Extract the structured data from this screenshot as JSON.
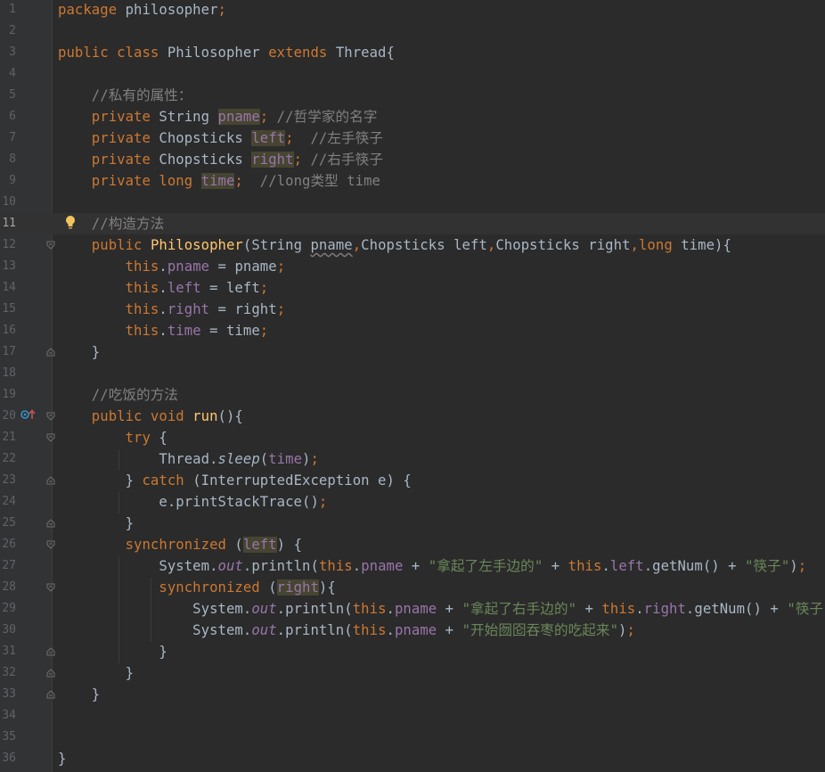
{
  "editor": {
    "current_line": 11,
    "lines": [
      {
        "num": "1",
        "tokens": [
          {
            "c": "kw",
            "t": "package"
          },
          {
            "t": " philosopher"
          },
          {
            "c": "kw",
            "t": ";"
          }
        ]
      },
      {
        "num": "2",
        "tokens": []
      },
      {
        "num": "3",
        "tokens": [
          {
            "c": "kw",
            "t": "public class "
          },
          {
            "t": "Philosopher "
          },
          {
            "c": "kw",
            "t": "extends "
          },
          {
            "t": "Thread{"
          }
        ]
      },
      {
        "num": "4",
        "tokens": []
      },
      {
        "num": "5",
        "tokens": [
          {
            "c": "cmt",
            "t": "    //私有的属性："
          }
        ]
      },
      {
        "num": "6",
        "tokens": [
          {
            "c": "kw",
            "t": "    private "
          },
          {
            "t": "String "
          },
          {
            "c": "fld hl",
            "t": "pname"
          },
          {
            "c": "kw",
            "t": ";"
          },
          {
            "c": "cmt",
            "t": " //哲学家的名字"
          }
        ]
      },
      {
        "num": "7",
        "tokens": [
          {
            "c": "kw",
            "t": "    private "
          },
          {
            "t": "Chopsticks "
          },
          {
            "c": "fld hl",
            "t": "left"
          },
          {
            "c": "kw",
            "t": ";"
          },
          {
            "c": "cmt",
            "t": "  //左手筷子"
          }
        ]
      },
      {
        "num": "8",
        "tokens": [
          {
            "c": "kw",
            "t": "    private "
          },
          {
            "t": "Chopsticks "
          },
          {
            "c": "fld hl",
            "t": "right"
          },
          {
            "c": "kw",
            "t": ";"
          },
          {
            "c": "cmt",
            "t": " //右手筷子"
          }
        ]
      },
      {
        "num": "9",
        "tokens": [
          {
            "c": "kw",
            "t": "    private long "
          },
          {
            "c": "fld hl",
            "t": "time"
          },
          {
            "c": "kw",
            "t": ";"
          },
          {
            "c": "cmt",
            "t": "  //long类型 time"
          }
        ]
      },
      {
        "num": "10",
        "tokens": []
      },
      {
        "num": "11",
        "tokens": [
          {
            "c": "cmt",
            "t": "    //构造方法"
          }
        ]
      },
      {
        "num": "12",
        "tokens": [
          {
            "c": "kw",
            "t": "    public "
          },
          {
            "c": "fn",
            "t": "Philosopher"
          },
          {
            "t": "(String "
          },
          {
            "c": "wav",
            "t": "pname"
          },
          {
            "c": "kw",
            "t": ","
          },
          {
            "t": "Chopsticks left"
          },
          {
            "c": "kw",
            "t": ","
          },
          {
            "t": "Chopsticks right"
          },
          {
            "c": "kw",
            "t": ","
          },
          {
            "c": "kw",
            "t": "long "
          },
          {
            "t": "time){"
          }
        ]
      },
      {
        "num": "13",
        "tokens": [
          {
            "c": "kw",
            "t": "        this"
          },
          {
            "t": "."
          },
          {
            "c": "fld",
            "t": "pname"
          },
          {
            "t": " = pname"
          },
          {
            "c": "kw",
            "t": ";"
          }
        ]
      },
      {
        "num": "14",
        "tokens": [
          {
            "c": "kw",
            "t": "        this"
          },
          {
            "t": "."
          },
          {
            "c": "fld",
            "t": "left"
          },
          {
            "t": " = left"
          },
          {
            "c": "kw",
            "t": ";"
          }
        ]
      },
      {
        "num": "15",
        "tokens": [
          {
            "c": "kw",
            "t": "        this"
          },
          {
            "t": "."
          },
          {
            "c": "fld",
            "t": "right"
          },
          {
            "t": " = right"
          },
          {
            "c": "kw",
            "t": ";"
          }
        ]
      },
      {
        "num": "16",
        "tokens": [
          {
            "c": "kw",
            "t": "        this"
          },
          {
            "t": "."
          },
          {
            "c": "fld",
            "t": "time"
          },
          {
            "t": " = time"
          },
          {
            "c": "kw",
            "t": ";"
          }
        ]
      },
      {
        "num": "17",
        "tokens": [
          {
            "t": "    }"
          }
        ]
      },
      {
        "num": "18",
        "tokens": []
      },
      {
        "num": "19",
        "tokens": [
          {
            "c": "cmt",
            "t": "    //吃饭的方法"
          }
        ]
      },
      {
        "num": "20",
        "tokens": [
          {
            "c": "kw",
            "t": "    public void "
          },
          {
            "c": "fn",
            "t": "run"
          },
          {
            "t": "(){"
          }
        ]
      },
      {
        "num": "21",
        "tokens": [
          {
            "c": "kw",
            "t": "        try "
          },
          {
            "t": "{"
          }
        ]
      },
      {
        "num": "22",
        "tokens": [
          {
            "t": "            Thread."
          },
          {
            "c": "sm",
            "t": "sleep"
          },
          {
            "t": "("
          },
          {
            "c": "fld",
            "t": "time"
          },
          {
            "t": ")"
          },
          {
            "c": "kw",
            "t": ";"
          }
        ]
      },
      {
        "num": "23",
        "tokens": [
          {
            "t": "        } "
          },
          {
            "c": "kw",
            "t": "catch "
          },
          {
            "t": "(InterruptedException e) {"
          }
        ]
      },
      {
        "num": "24",
        "tokens": [
          {
            "t": "            e.printStackTrace()"
          },
          {
            "c": "kw",
            "t": ";"
          }
        ]
      },
      {
        "num": "25",
        "tokens": [
          {
            "t": "        }"
          }
        ]
      },
      {
        "num": "26",
        "tokens": [
          {
            "c": "kw",
            "t": "        synchronized "
          },
          {
            "t": "("
          },
          {
            "c": "fld hl",
            "t": "left"
          },
          {
            "t": ") {"
          }
        ]
      },
      {
        "num": "27",
        "tokens": [
          {
            "t": "            System."
          },
          {
            "c": "st",
            "t": "out"
          },
          {
            "t": ".println("
          },
          {
            "c": "kw",
            "t": "this"
          },
          {
            "t": "."
          },
          {
            "c": "fld",
            "t": "pname"
          },
          {
            "t": " + "
          },
          {
            "c": "str",
            "t": "\"拿起了左手边的\""
          },
          {
            "t": " + "
          },
          {
            "c": "kw",
            "t": "this"
          },
          {
            "t": "."
          },
          {
            "c": "fld",
            "t": "left"
          },
          {
            "t": ".getNum() + "
          },
          {
            "c": "str",
            "t": "\"筷子\""
          },
          {
            "t": ")"
          },
          {
            "c": "kw",
            "t": ";"
          }
        ]
      },
      {
        "num": "28",
        "tokens": [
          {
            "c": "kw",
            "t": "            synchronized "
          },
          {
            "t": "("
          },
          {
            "c": "fld hl",
            "t": "right"
          },
          {
            "t": "){"
          }
        ]
      },
      {
        "num": "29",
        "tokens": [
          {
            "t": "                System."
          },
          {
            "c": "st",
            "t": "out"
          },
          {
            "t": ".println("
          },
          {
            "c": "kw",
            "t": "this"
          },
          {
            "t": "."
          },
          {
            "c": "fld",
            "t": "pname"
          },
          {
            "t": " + "
          },
          {
            "c": "str",
            "t": "\"拿起了右手边的\""
          },
          {
            "t": " + "
          },
          {
            "c": "kw",
            "t": "this"
          },
          {
            "t": "."
          },
          {
            "c": "fld",
            "t": "right"
          },
          {
            "t": ".getNum() + "
          },
          {
            "c": "str",
            "t": "\"筷子\""
          },
          {
            "t": ")"
          },
          {
            "c": "kw",
            "t": ";"
          }
        ]
      },
      {
        "num": "30",
        "tokens": [
          {
            "t": "                System."
          },
          {
            "c": "st",
            "t": "out"
          },
          {
            "t": ".println("
          },
          {
            "c": "kw",
            "t": "this"
          },
          {
            "t": "."
          },
          {
            "c": "fld",
            "t": "pname"
          },
          {
            "t": " + "
          },
          {
            "c": "str",
            "t": "\"开始囫囵吞枣的吃起来\""
          },
          {
            "t": ")"
          },
          {
            "c": "kw",
            "t": ";"
          }
        ]
      },
      {
        "num": "31",
        "tokens": [
          {
            "t": "            }"
          }
        ]
      },
      {
        "num": "32",
        "tokens": [
          {
            "t": "        }"
          }
        ]
      },
      {
        "num": "33",
        "tokens": [
          {
            "t": "    }"
          }
        ]
      },
      {
        "num": "34",
        "tokens": []
      },
      {
        "num": "35",
        "tokens": []
      },
      {
        "num": "36",
        "tokens": [
          {
            "t": "}"
          }
        ]
      }
    ],
    "fold_open_lines": [
      12,
      20,
      21,
      26,
      28
    ],
    "fold_close_lines": [
      17,
      23,
      25,
      31,
      32,
      33
    ],
    "gutter_icons": {
      "intention_bulb_line": 11,
      "override_marker_line": 20
    },
    "colors": {
      "background": "#2b2b2b",
      "keyword": "#cc7832",
      "field": "#9876aa",
      "string": "#6a8759",
      "comment": "#808080",
      "method": "#ffc66d",
      "text": "#a9b7c6"
    }
  }
}
